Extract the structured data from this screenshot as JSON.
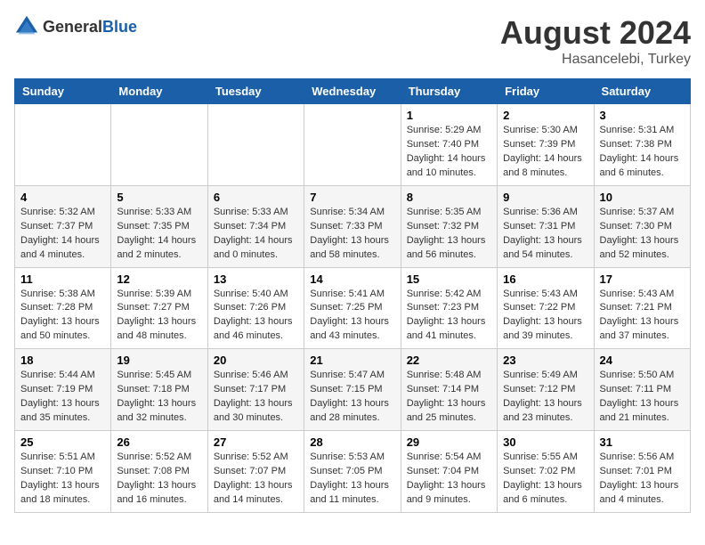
{
  "header": {
    "logo_general": "General",
    "logo_blue": "Blue",
    "month_year": "August 2024",
    "location": "Hasancelebi, Turkey"
  },
  "days_of_week": [
    "Sunday",
    "Monday",
    "Tuesday",
    "Wednesday",
    "Thursday",
    "Friday",
    "Saturday"
  ],
  "weeks": [
    {
      "days": [
        {
          "num": "",
          "info": ""
        },
        {
          "num": "",
          "info": ""
        },
        {
          "num": "",
          "info": ""
        },
        {
          "num": "",
          "info": ""
        },
        {
          "num": "1",
          "info": "Sunrise: 5:29 AM\nSunset: 7:40 PM\nDaylight: 14 hours\nand 10 minutes."
        },
        {
          "num": "2",
          "info": "Sunrise: 5:30 AM\nSunset: 7:39 PM\nDaylight: 14 hours\nand 8 minutes."
        },
        {
          "num": "3",
          "info": "Sunrise: 5:31 AM\nSunset: 7:38 PM\nDaylight: 14 hours\nand 6 minutes."
        }
      ]
    },
    {
      "days": [
        {
          "num": "4",
          "info": "Sunrise: 5:32 AM\nSunset: 7:37 PM\nDaylight: 14 hours\nand 4 minutes."
        },
        {
          "num": "5",
          "info": "Sunrise: 5:33 AM\nSunset: 7:35 PM\nDaylight: 14 hours\nand 2 minutes."
        },
        {
          "num": "6",
          "info": "Sunrise: 5:33 AM\nSunset: 7:34 PM\nDaylight: 14 hours\nand 0 minutes."
        },
        {
          "num": "7",
          "info": "Sunrise: 5:34 AM\nSunset: 7:33 PM\nDaylight: 13 hours\nand 58 minutes."
        },
        {
          "num": "8",
          "info": "Sunrise: 5:35 AM\nSunset: 7:32 PM\nDaylight: 13 hours\nand 56 minutes."
        },
        {
          "num": "9",
          "info": "Sunrise: 5:36 AM\nSunset: 7:31 PM\nDaylight: 13 hours\nand 54 minutes."
        },
        {
          "num": "10",
          "info": "Sunrise: 5:37 AM\nSunset: 7:30 PM\nDaylight: 13 hours\nand 52 minutes."
        }
      ]
    },
    {
      "days": [
        {
          "num": "11",
          "info": "Sunrise: 5:38 AM\nSunset: 7:28 PM\nDaylight: 13 hours\nand 50 minutes."
        },
        {
          "num": "12",
          "info": "Sunrise: 5:39 AM\nSunset: 7:27 PM\nDaylight: 13 hours\nand 48 minutes."
        },
        {
          "num": "13",
          "info": "Sunrise: 5:40 AM\nSunset: 7:26 PM\nDaylight: 13 hours\nand 46 minutes."
        },
        {
          "num": "14",
          "info": "Sunrise: 5:41 AM\nSunset: 7:25 PM\nDaylight: 13 hours\nand 43 minutes."
        },
        {
          "num": "15",
          "info": "Sunrise: 5:42 AM\nSunset: 7:23 PM\nDaylight: 13 hours\nand 41 minutes."
        },
        {
          "num": "16",
          "info": "Sunrise: 5:43 AM\nSunset: 7:22 PM\nDaylight: 13 hours\nand 39 minutes."
        },
        {
          "num": "17",
          "info": "Sunrise: 5:43 AM\nSunset: 7:21 PM\nDaylight: 13 hours\nand 37 minutes."
        }
      ]
    },
    {
      "days": [
        {
          "num": "18",
          "info": "Sunrise: 5:44 AM\nSunset: 7:19 PM\nDaylight: 13 hours\nand 35 minutes."
        },
        {
          "num": "19",
          "info": "Sunrise: 5:45 AM\nSunset: 7:18 PM\nDaylight: 13 hours\nand 32 minutes."
        },
        {
          "num": "20",
          "info": "Sunrise: 5:46 AM\nSunset: 7:17 PM\nDaylight: 13 hours\nand 30 minutes."
        },
        {
          "num": "21",
          "info": "Sunrise: 5:47 AM\nSunset: 7:15 PM\nDaylight: 13 hours\nand 28 minutes."
        },
        {
          "num": "22",
          "info": "Sunrise: 5:48 AM\nSunset: 7:14 PM\nDaylight: 13 hours\nand 25 minutes."
        },
        {
          "num": "23",
          "info": "Sunrise: 5:49 AM\nSunset: 7:12 PM\nDaylight: 13 hours\nand 23 minutes."
        },
        {
          "num": "24",
          "info": "Sunrise: 5:50 AM\nSunset: 7:11 PM\nDaylight: 13 hours\nand 21 minutes."
        }
      ]
    },
    {
      "days": [
        {
          "num": "25",
          "info": "Sunrise: 5:51 AM\nSunset: 7:10 PM\nDaylight: 13 hours\nand 18 minutes."
        },
        {
          "num": "26",
          "info": "Sunrise: 5:52 AM\nSunset: 7:08 PM\nDaylight: 13 hours\nand 16 minutes."
        },
        {
          "num": "27",
          "info": "Sunrise: 5:52 AM\nSunset: 7:07 PM\nDaylight: 13 hours\nand 14 minutes."
        },
        {
          "num": "28",
          "info": "Sunrise: 5:53 AM\nSunset: 7:05 PM\nDaylight: 13 hours\nand 11 minutes."
        },
        {
          "num": "29",
          "info": "Sunrise: 5:54 AM\nSunset: 7:04 PM\nDaylight: 13 hours\nand 9 minutes."
        },
        {
          "num": "30",
          "info": "Sunrise: 5:55 AM\nSunset: 7:02 PM\nDaylight: 13 hours\nand 6 minutes."
        },
        {
          "num": "31",
          "info": "Sunrise: 5:56 AM\nSunset: 7:01 PM\nDaylight: 13 hours\nand 4 minutes."
        }
      ]
    }
  ]
}
